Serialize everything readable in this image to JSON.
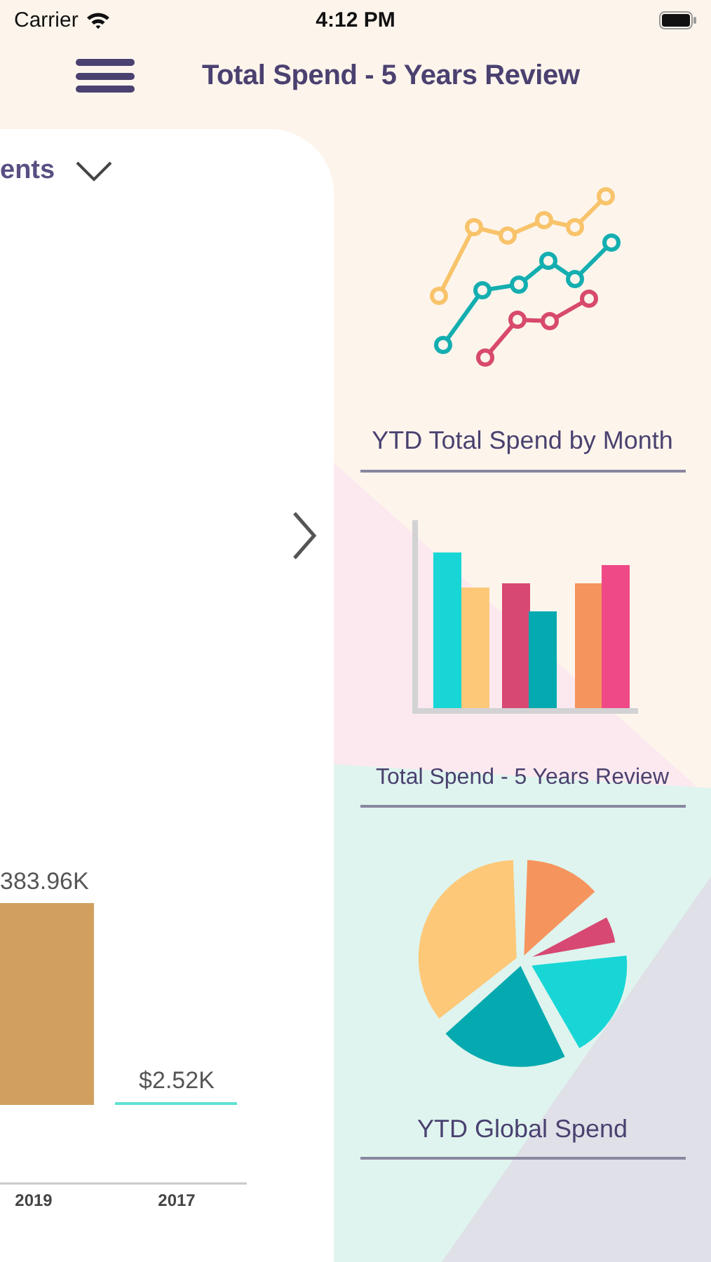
{
  "status_bar": {
    "carrier": "Carrier",
    "time": "4:12 PM"
  },
  "header": {
    "title": "Total Spend - 5 Years Review"
  },
  "report_panel": {
    "selector_label": "ents",
    "chart_data": {
      "type": "bar",
      "categories": [
        "2019",
        "2017"
      ],
      "values": [
        383.96,
        2.52
      ],
      "colors": [
        "#d1a060",
        "#5fe0d2"
      ],
      "data_labels": true,
      "value_labels": [
        "383.96K",
        "$2.52K"
      ]
    }
  },
  "menu": {
    "items": [
      {
        "title": "YTD Total Spend by Month",
        "kind": "line"
      },
      {
        "title": "Total Spend - 5 Years Review",
        "kind": "bar"
      },
      {
        "title": "YTD Global Spend",
        "kind": "pie"
      }
    ]
  }
}
